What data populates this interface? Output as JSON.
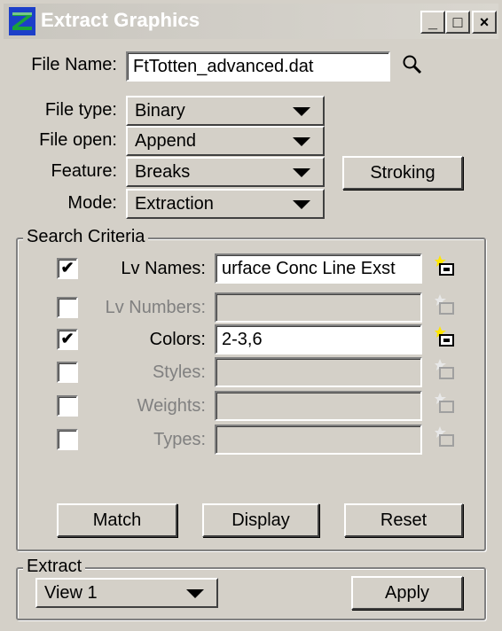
{
  "window": {
    "title": "Extract Graphics",
    "minimize_glyph": "_",
    "maximize_glyph": "□",
    "close_glyph": "×"
  },
  "file_name": {
    "label": "File Name:",
    "value": "FtTotten_advanced.dat",
    "search_icon": "search-icon"
  },
  "file_type": {
    "label": "File type:",
    "value": "Binary"
  },
  "file_open": {
    "label": "File open:",
    "value": "Append"
  },
  "feature": {
    "label": "Feature:",
    "value": "Breaks"
  },
  "mode": {
    "label": "Mode:",
    "value": "Extraction"
  },
  "stroking_button": "Stroking",
  "search_criteria": {
    "legend": "Search Criteria",
    "rows": [
      {
        "label": "Lv Names:",
        "checked": "✔",
        "value": "urface Conc Line Exst",
        "enabled": true
      },
      {
        "label": "Lv Numbers:",
        "checked": "",
        "value": "",
        "enabled": false
      },
      {
        "label": "Colors:",
        "checked": "✔",
        "value": "2-3,6",
        "enabled": true
      },
      {
        "label": "Styles:",
        "checked": "",
        "value": "",
        "enabled": false
      },
      {
        "label": "Weights:",
        "checked": "",
        "value": "",
        "enabled": false
      },
      {
        "label": "Types:",
        "checked": "",
        "value": "",
        "enabled": false
      }
    ],
    "match_button": "Match",
    "display_button": "Display",
    "reset_button": "Reset"
  },
  "extract": {
    "legend": "Extract",
    "view_value": "View 1",
    "apply_button": "Apply"
  },
  "colors": {
    "face": "#d4d0c8",
    "disabled_text": "#808080",
    "picker_star": "#ffe600",
    "icon_blue": "#1c3fc9",
    "icon_green": "#1aa33a"
  }
}
